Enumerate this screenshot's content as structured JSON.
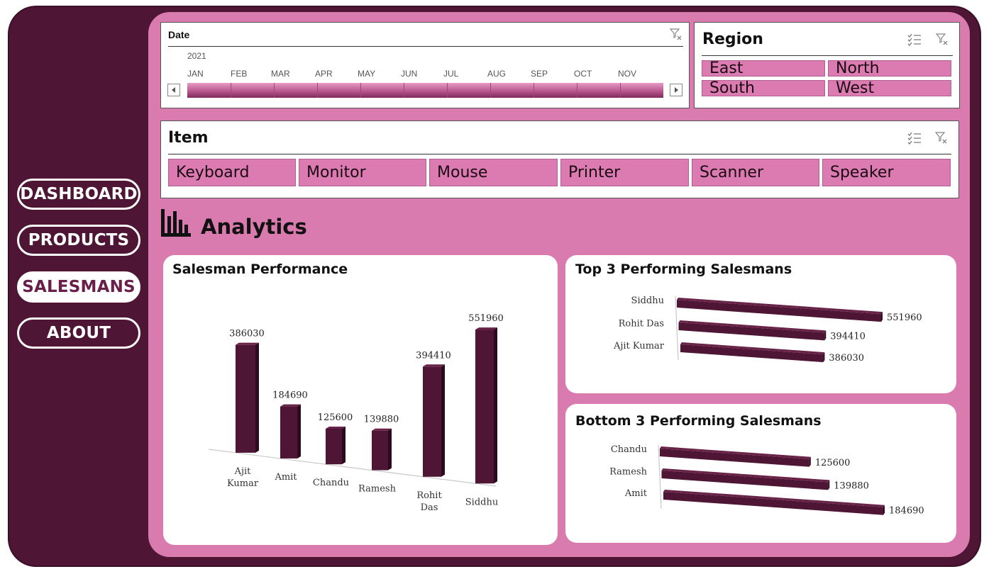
{
  "nav": {
    "items": [
      {
        "label": "DASHBOARD",
        "active": false
      },
      {
        "label": "PRODUCTS",
        "active": false
      },
      {
        "label": "SALESMANS",
        "active": true
      },
      {
        "label": "ABOUT",
        "active": false
      }
    ]
  },
  "date_slicer": {
    "title": "Date",
    "year": "2021",
    "months": [
      "JAN",
      "FEB",
      "MAR",
      "APR",
      "MAY",
      "JUN",
      "JUL",
      "AUG",
      "SEP",
      "OCT",
      "NOV"
    ],
    "clear_filter_icon": "clear-filter-icon"
  },
  "region_slicer": {
    "title": "Region",
    "items": [
      "East",
      "North",
      "South",
      "West"
    ]
  },
  "item_slicer": {
    "title": "Item",
    "items": [
      "Keyboard",
      "Monitor",
      "Mouse",
      "Printer",
      "Scanner",
      "Speaker"
    ]
  },
  "section": {
    "title": "Analytics",
    "icon": "bar-chart-icon"
  },
  "colors": {
    "frame": "#4e1535",
    "background": "#da7bb0",
    "bar": "#4e1535",
    "tile": "#dc7bb1"
  },
  "chart_data": [
    {
      "type": "bar",
      "title": "Salesman Performance",
      "categories": [
        "Ajit Kumar",
        "Amit",
        "Chandu",
        "Ramesh",
        "Rohit Das",
        "Siddhu"
      ],
      "values": [
        386030,
        184690,
        125600,
        139880,
        394410,
        551960
      ]
    },
    {
      "type": "bar",
      "orientation": "horizontal",
      "title": "Top 3 Performing Salesmans",
      "categories": [
        "Siddhu",
        "Rohit Das",
        "Ajit Kumar"
      ],
      "values": [
        551960,
        394410,
        386030
      ]
    },
    {
      "type": "bar",
      "orientation": "horizontal",
      "title": "Bottom 3 Performing Salesmans",
      "categories": [
        "Chandu",
        "Ramesh",
        "Amit"
      ],
      "values": [
        125600,
        139880,
        184690
      ]
    }
  ]
}
